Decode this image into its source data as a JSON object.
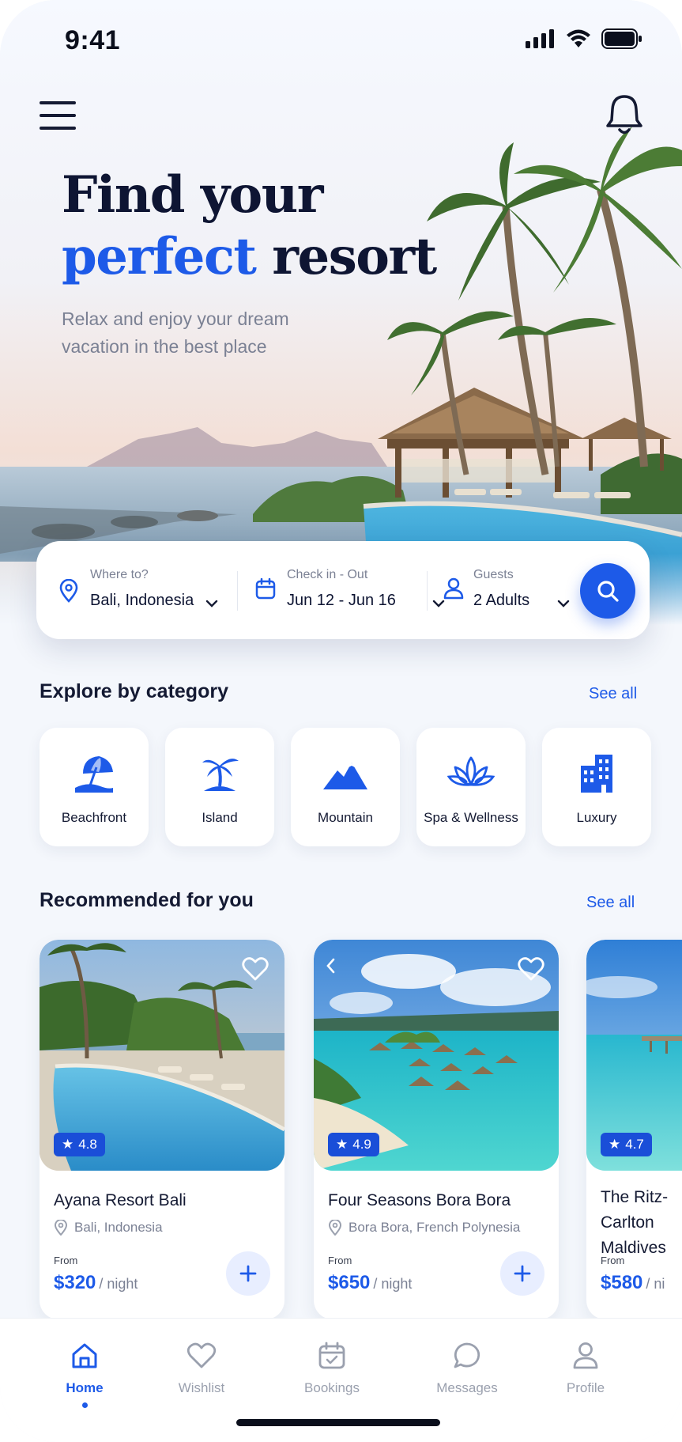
{
  "status_bar": {
    "time": "9:41"
  },
  "hero": {
    "title_line1": "Find your",
    "title_accent": "perfect",
    "title_rest": " resort",
    "subtitle": "Relax and enjoy your dream vacation in the best place"
  },
  "search": {
    "destination": {
      "label": "Where to?",
      "value": "Bali, Indonesia"
    },
    "dates": {
      "label": "Check in - Out",
      "value": "Jun 12 - Jun 16"
    },
    "guests": {
      "label": "Guests",
      "value": "2 Adults"
    }
  },
  "categories": {
    "title": "Explore by category",
    "see_all": "See all",
    "items": [
      {
        "label": "Beachfront",
        "icon": "beach-umbrella-icon"
      },
      {
        "label": "Island",
        "icon": "palm-island-icon"
      },
      {
        "label": "Mountain",
        "icon": "mountain-icon"
      },
      {
        "label": "Spa & Wellness",
        "icon": "lotus-icon"
      },
      {
        "label": "Luxury",
        "icon": "building-icon"
      }
    ]
  },
  "recommended": {
    "title": "Recommended for you",
    "see_all": "See all",
    "resorts": [
      {
        "name": "Ayana Resort Bali",
        "location": "Bali, Indonesia",
        "rating": "4.8",
        "from": "From",
        "price": "$320",
        "per": "/ night"
      },
      {
        "name": "Four Seasons Bora Bora",
        "location": "Bora Bora, French Polynesia",
        "rating": "4.9",
        "from": "From",
        "price": "$650",
        "per": "/ night"
      },
      {
        "name": "The Ritz-Carlton Maldives",
        "location": "",
        "rating": "4.7",
        "from": "From",
        "price": "$580",
        "per": "/ ni"
      }
    ]
  },
  "bottom_nav": {
    "items": [
      {
        "label": "Home",
        "icon": "home-icon",
        "active": true
      },
      {
        "label": "Wishlist",
        "icon": "heart-icon"
      },
      {
        "label": "Bookings",
        "icon": "calendar-icon"
      },
      {
        "label": "Messages",
        "icon": "chat-icon"
      },
      {
        "label": "Profile",
        "icon": "user-icon"
      }
    ]
  },
  "colors": {
    "accent": "#1d5ae8",
    "text": "#141a33",
    "muted": "#7b8194"
  }
}
